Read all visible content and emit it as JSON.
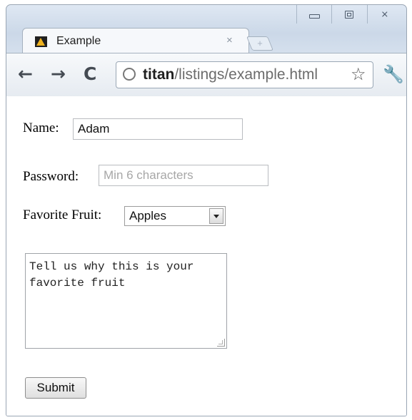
{
  "browser": {
    "tab_title": "Example",
    "tab_close": "×",
    "new_tab": "+",
    "nav": {
      "back": "←",
      "forward": "→",
      "reload": "C"
    },
    "address": {
      "host": "titan",
      "path": "/listings/example.html"
    },
    "window_controls": {
      "close": "⨯"
    },
    "icons": {
      "favicon": "warning-triangle-icon",
      "globe": "globe-icon",
      "star": "star-icon",
      "wrench": "wrench-icon"
    }
  },
  "form": {
    "name_label": "Name:",
    "name_value": "Adam",
    "password_label": "Password:",
    "password_placeholder": "Min 6 characters",
    "fruit_label": "Favorite Fruit:",
    "fruit_selected": "Apples",
    "textarea_text": "Tell us why this is your favorite fruit",
    "submit_label": "Submit"
  }
}
